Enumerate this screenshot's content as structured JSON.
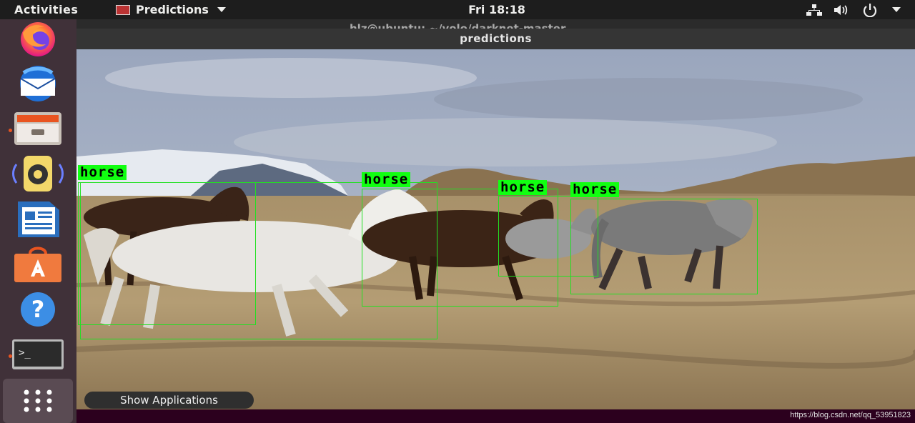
{
  "topbar": {
    "activities": "Activities",
    "app_name": "Predictions",
    "clock": "Fri 18:18"
  },
  "dock": {
    "apps": [
      "Firefox",
      "Thunderbird",
      "Files",
      "Rhythmbox",
      "LibreOffice Writer",
      "Ubuntu Software",
      "Help",
      "Terminal"
    ],
    "tooltip": "Show Applications"
  },
  "window": {
    "behind_title": "hlz@ubuntu: ~/yolo/darknet-master",
    "title": "predictions"
  },
  "detections": [
    {
      "label": "horse"
    },
    {
      "label": "horse"
    },
    {
      "label": "horse"
    },
    {
      "label": "horse"
    }
  ],
  "watermark": "https://blog.csdn.net/qq_53951823",
  "colors": {
    "box": "#22e022",
    "label_bg": "#11ff11",
    "accent": "#e95420"
  }
}
